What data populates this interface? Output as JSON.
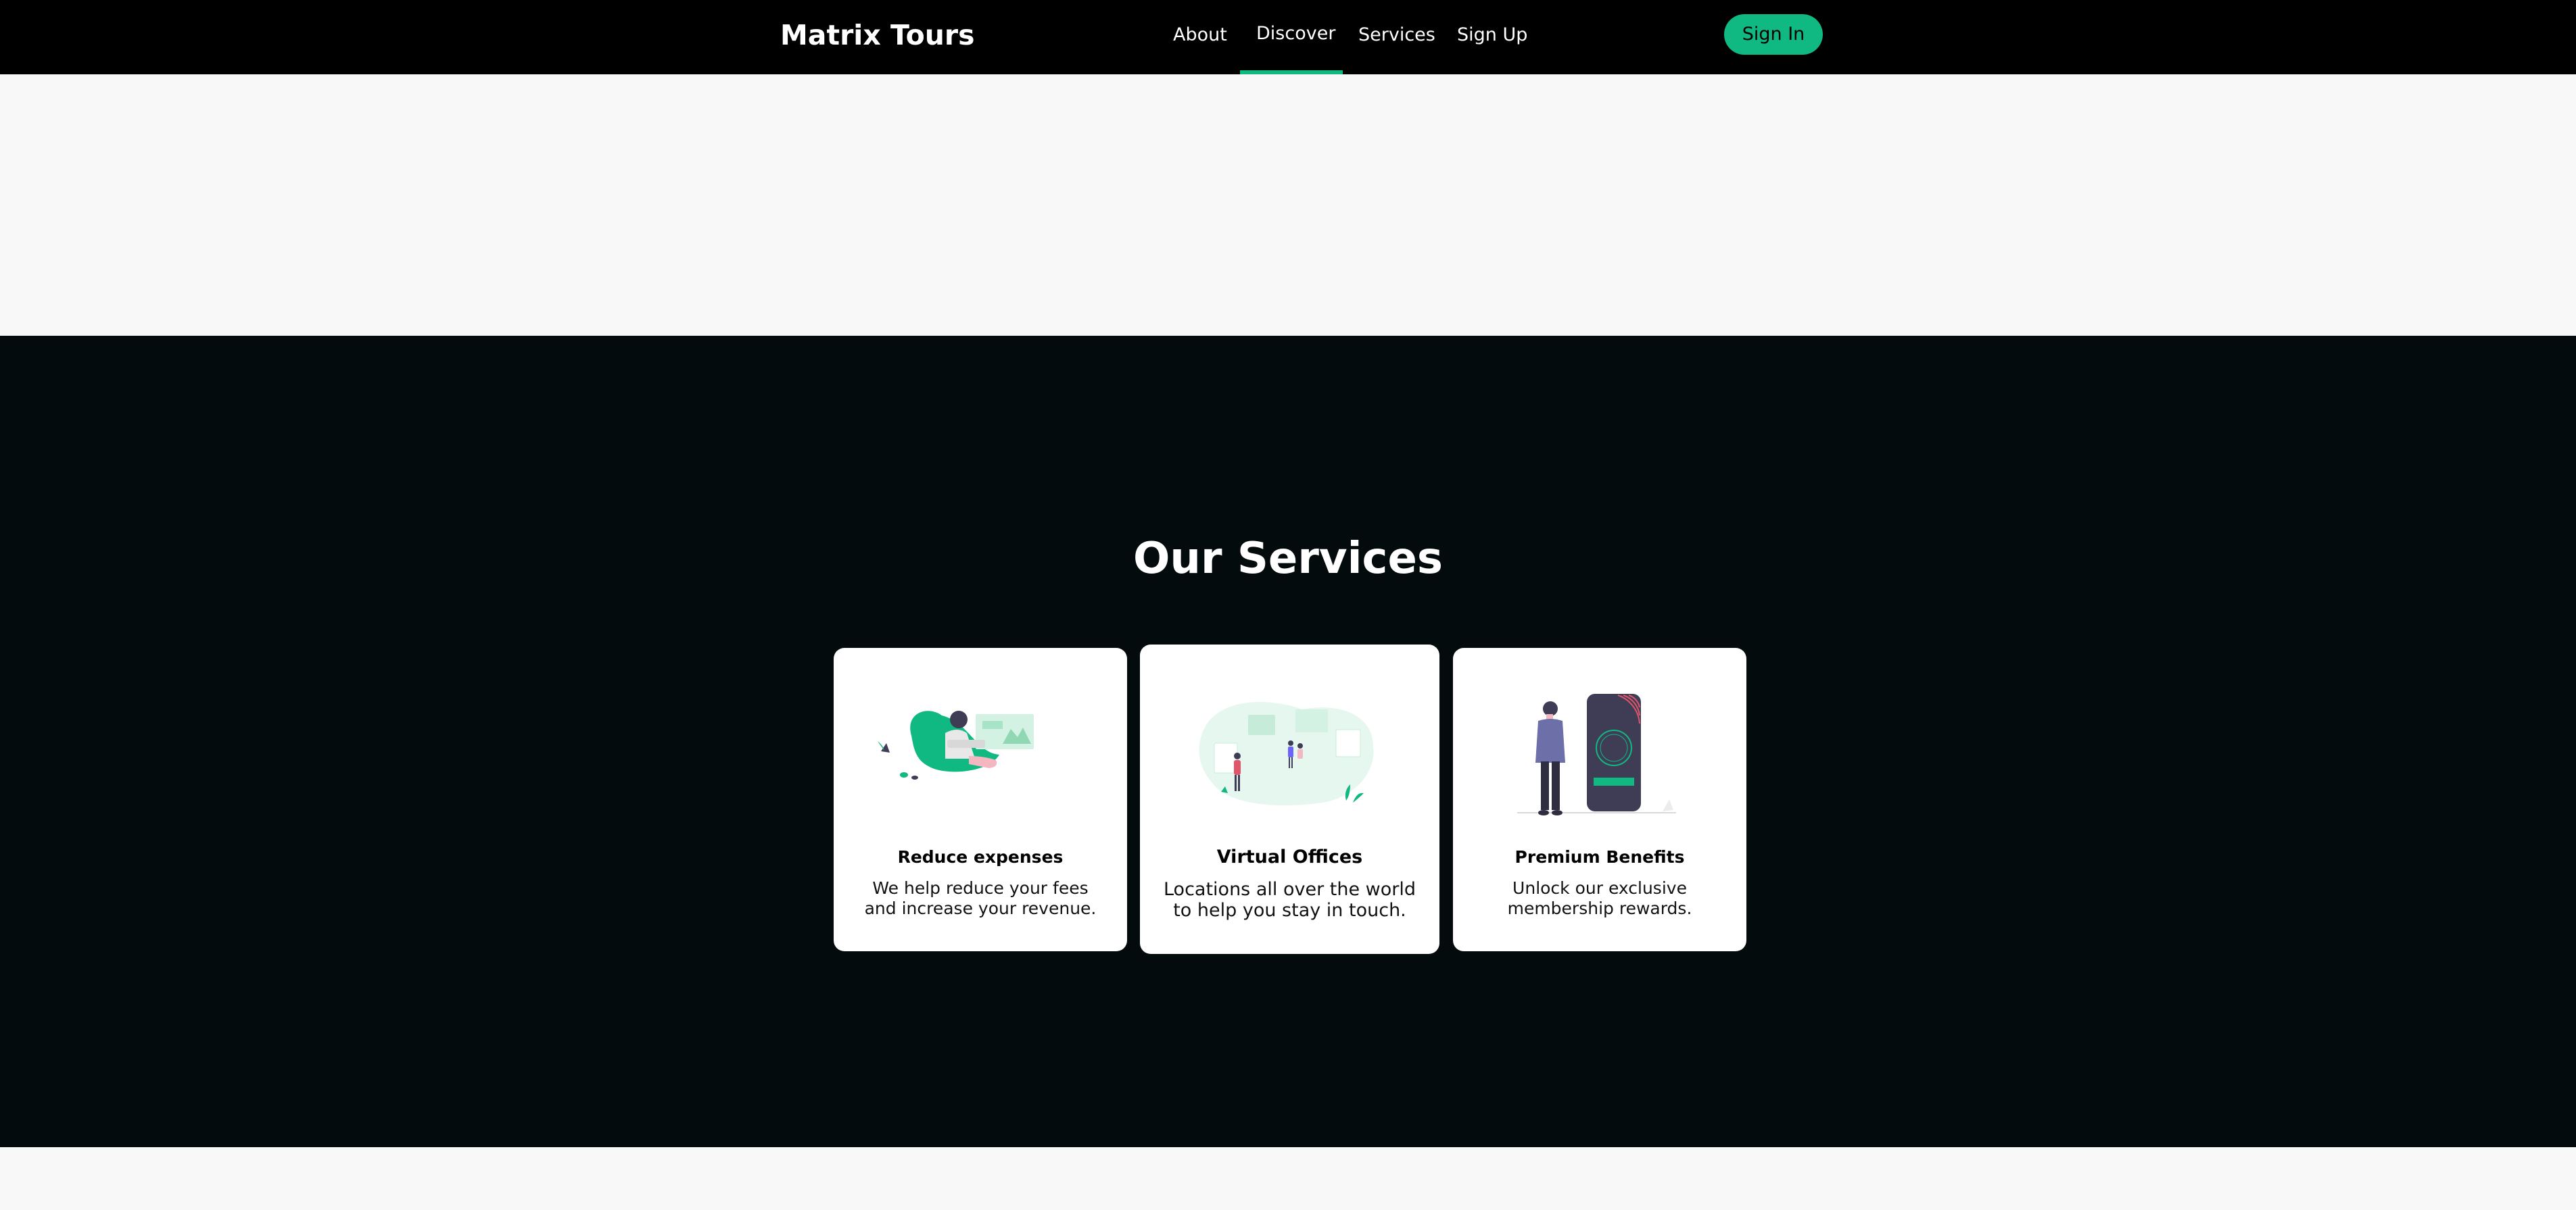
{
  "navbar": {
    "logo": "Matrix Tours",
    "links": [
      "About",
      "Discover",
      "Services",
      "Sign Up"
    ],
    "active_link": "Discover",
    "signin_label": "Sign In"
  },
  "services": {
    "title": "Our Services",
    "cards": [
      {
        "title": "Reduce expenses",
        "description": "We help reduce your fees and increase your revenue.",
        "illustration": "person-relaxing-on-beanbag-with-charts"
      },
      {
        "title": "Virtual Offices",
        "description": "Locations all over the world to help you stay in touch.",
        "illustration": "people-in-virtual-gallery"
      },
      {
        "title": "Premium Benefits",
        "description": "Unlock our exclusive membership rewards.",
        "illustration": "person-beside-giant-phone"
      }
    ]
  },
  "colors": {
    "accent": "#10b981",
    "navbar_bg": "#000000",
    "services_bg": "#040b0c",
    "page_bg": "#f8f8f8",
    "card_bg": "#ffffff"
  }
}
